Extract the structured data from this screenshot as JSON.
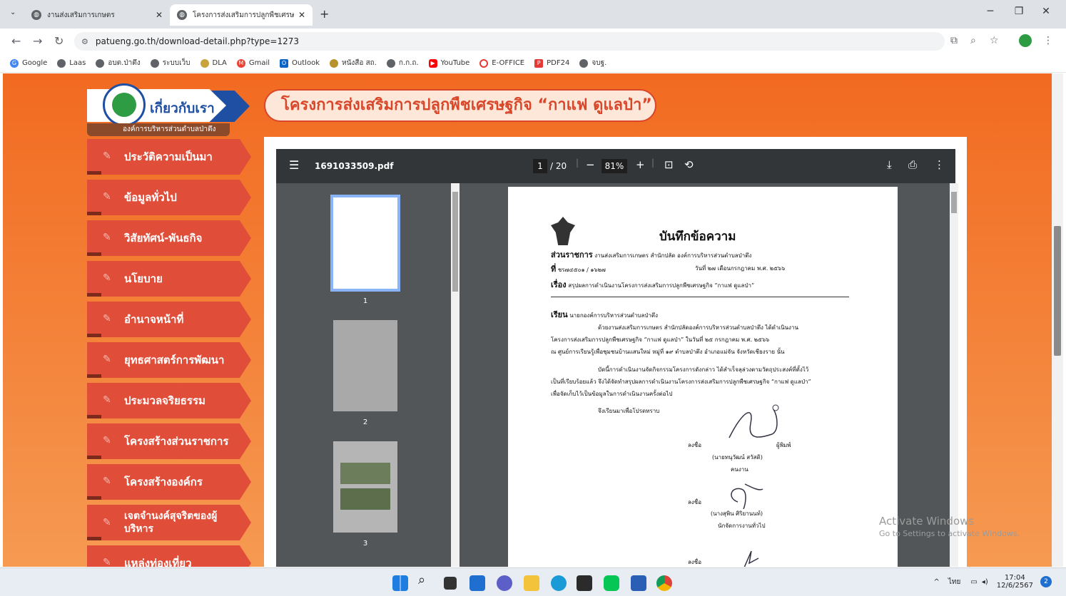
{
  "browser": {
    "tabs": [
      {
        "title": "งานส่งเสริมการเกษตร",
        "active": false
      },
      {
        "title": "โครงการส่งเสริมการปลูกพืชเศรษฐกิจ",
        "active": true
      }
    ],
    "new_tab": "+",
    "url": "patueng.go.th/download-detail.php?type=1273",
    "bookmarks": [
      "Google",
      "Laas",
      "อบต.ป่าตึง",
      "ระบบเว็บ",
      "DLA",
      "Gmail",
      "Outlook",
      "หนังสือ สถ.",
      "ก.ก.ถ.",
      "YouTube",
      "E-OFFICE",
      "PDF24",
      "จบฐ."
    ]
  },
  "site": {
    "about_title": "เกี่ยวกับเรา",
    "org_name": "องค์การบริหารส่วนตำบลป่าตึง",
    "project_title": "โครงการส่งเสริมการปลูกพืชเศรษฐกิจ “กาแฟ ดูแลป่า”",
    "menu": [
      "ประวัติความเป็นมา",
      "ข้อมูลทั่วไป",
      "วิสัยทัศน์-พันธกิจ",
      "นโยบาย",
      "อำนาจหน้าที่",
      "ยุทธศาสตร์การพัฒนา",
      "ประมวลจริยธรรม",
      "โครงสร้างส่วนราชการ",
      "โครงสร้างองค์กร",
      "เจตจำนงค์สุจริตของผู้บริหาร",
      "แหล่งท่องเที่ยว"
    ]
  },
  "pdf": {
    "filename": "1691033509.pdf",
    "page": "1",
    "total": "/ 20",
    "zoom": "81%",
    "thumb_labels": [
      "1",
      "2",
      "3"
    ],
    "doc": {
      "heading": "บันทึกข้อความ",
      "agency_label": "ส่วนราชการ",
      "agency": "งานส่งเสริมการเกษตร สำนักปลัด องค์การบริหารส่วนตำบลป่าตึง",
      "ref_label": "ที่",
      "ref": "ชร๗๔๕๐๑ / ๑๖๒๗",
      "date": "วันที่ ๒๗ เดือนกรกฎาคม พ.ศ. ๒๕๖๖",
      "subject_label": "เรื่อง",
      "subject": "สรุปผลการดำเนินงานโครงการส่งเสริมการปลูกพืชเศรษฐกิจ “กาแฟ ดูแลป่า”",
      "to_label": "เรียน",
      "to": "นายกองค์การบริหารส่วนตำบลป่าตึง",
      "p1": [
        "ด้วยงานส่งเสริมการเกษตร สำนักปลัดองค์การบริหารส่วนตำบลป่าตึง ได้ดำเนินงาน",
        "โครงการส่งเสริมการปลูกพืชเศรษฐกิจ “กาแฟ ดูแลป่า” ในวันที่ ๒๕ กรกฎาคม พ.ศ. ๒๕๖๖",
        "ณ ศูนย์การเรียนรู้เพื่อชุมชนบ้านแสนใหม่ หมู่ที่ ๑๙ ตำบลป่าตึง อำเภอแม่จัน จังหวัดเชียงราย นั้น"
      ],
      "p2": [
        "บัดนี้การดำเนินงานจัดกิจกรรมโครงการดังกล่าว ได้สำเร็จลุล่วงตามวัตถุประสงค์ที่ตั้งไว้",
        "เป็นที่เรียบร้อยแล้ว จึงได้จัดทำสรุปผลการดำเนินงานโครงการส่งเสริมการปลูกพืชเศรษฐกิจ “กาแฟ ดูแลป่า”",
        "เพื่อจัดเก็บไว้เป็นข้อมูลในการดำเนินงานครั้งต่อไป"
      ],
      "closing": "จึงเรียนมาเพื่อโปรดทราบ",
      "sign_label": "ลงชื่อ",
      "typist": "ผู้พิมพ์",
      "signer1": "(นายทนุวัฒน์   สวัสดิ)",
      "role1": "คนงาน",
      "signer2": "(นางสุพิน   ศิริยานนท์)",
      "role2": "นักจัดการงานทั่วไป"
    }
  },
  "watermark": {
    "line1": "Activate Windows",
    "line2": "Go to Settings to activate Windows."
  },
  "taskbar": {
    "lang": "ไทย",
    "time": "17:04",
    "date": "12/6/2567",
    "badge": "2"
  }
}
